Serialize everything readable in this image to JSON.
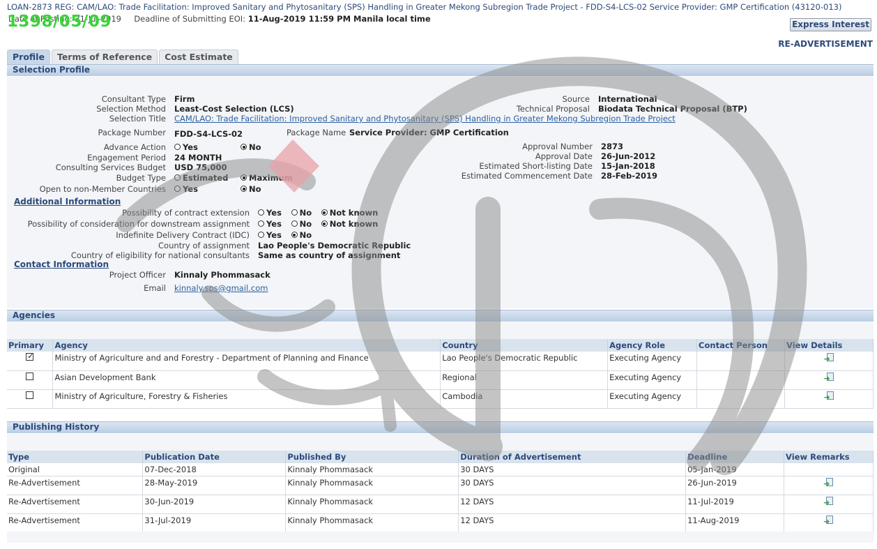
{
  "header": {
    "title": "LOAN-2873 REG: CAM/LAO: Trade Facilitation: Improved Sanitary and Phytosanitary (SPS) Handling in Greater Mekong Subregion Trade Project - FDD-S4-LCS-02 Service Provider: GMP Certification (43120-013)",
    "date_label": "Date of Posting:",
    "date_value": "31-Jul-2019",
    "deadline_label": "Deadline of Submitting EOI:",
    "deadline_value": "11-Aug-2019 11:59 PM Manila local time",
    "stamp": "1398/05/09",
    "express_button": "Express Interest",
    "status": "RE-ADVERTISEMENT"
  },
  "tabs": [
    {
      "label": "Profile",
      "active": true
    },
    {
      "label": "Terms of Reference",
      "active": false
    },
    {
      "label": "Cost Estimate",
      "active": false
    }
  ],
  "selection_profile": {
    "heading": "Selection Profile",
    "consultant_type_label": "Consultant Type",
    "consultant_type": "Firm",
    "selection_method_label": "Selection Method",
    "selection_method": "Least-Cost Selection (LCS)",
    "selection_title_label": "Selection Title",
    "selection_title": "CAM/LAO: Trade Facilitation: Improved Sanitary and Phytosanitary (SPS) Handling in Greater Mekong Subregion Trade Project",
    "package_number_label": "Package Number",
    "package_number": "FDD-S4-LCS-02",
    "package_name_label": "Package Name",
    "package_name": "Service Provider: GMP Certification",
    "advance_action_label": "Advance Action",
    "engagement_period_label": "Engagement Period",
    "engagement_period": "24 MONTH",
    "budget_label": "Consulting Services Budget",
    "budget": "USD 75,000",
    "budget_type_label": "Budget Type",
    "budget_type_estimated": "Estimated",
    "budget_type_maximum": "Maximum",
    "non_member_label": "Open to non-Member Countries",
    "yes": "Yes",
    "no": "No",
    "not_known": "Not known",
    "source_label": "Source",
    "source": "International",
    "technical_proposal_label": "Technical Proposal",
    "technical_proposal": "Biodata Technical Proposal (BTP)",
    "approval_number_label": "Approval Number",
    "approval_number": "2873",
    "approval_date_label": "Approval Date",
    "approval_date": "26-Jun-2012",
    "shortlisting_label": "Estimated Short-listing Date",
    "shortlisting_date": "15-Jan-2018",
    "commencement_label": "Estimated Commencement Date",
    "commencement_date": "28-Feb-2019"
  },
  "additional_info": {
    "heading": "Additional Information",
    "extension_label": "Possibility of contract extension",
    "downstream_label": "Possibility of consideration for downstream assignment",
    "idc_label": "Indefinite Delivery Contract (IDC)",
    "country_label": "Country of assignment",
    "country": "Lao People's Democratic Republic",
    "eligibility_label": "Country of eligibility for national consultants",
    "eligibility": "Same as country of assignment"
  },
  "contact_info": {
    "heading": "Contact Information",
    "officer_label": "Project Officer",
    "officer": "Kinnaly Phommasack",
    "email_label": "Email",
    "email": "kinnaly.sps@gmail.com"
  },
  "agencies": {
    "heading": "Agencies",
    "columns": [
      "Primary",
      "Agency",
      "Country",
      "Agency Role",
      "Contact Person",
      "View Details"
    ],
    "rows": [
      {
        "primary": true,
        "agency": "Ministry of Agriculture and and Forestry - Department of Planning and Finance",
        "country": "Lao People's Democratic Republic",
        "role": "Executing Agency",
        "contact": ""
      },
      {
        "primary": false,
        "agency": "Asian Development Bank",
        "country": "Regional",
        "role": "Executing Agency",
        "contact": ""
      },
      {
        "primary": false,
        "agency": "Ministry of Agriculture, Forestry & Fisheries",
        "country": "Cambodia",
        "role": "Executing Agency",
        "contact": ""
      }
    ]
  },
  "publishing": {
    "heading": "Publishing History",
    "columns": [
      "Type",
      "Publication Date",
      "Published By",
      "Duration of Advertisement",
      "Deadline",
      "View Remarks"
    ],
    "rows": [
      {
        "type": "Original",
        "date": "07-Dec-2018",
        "by": "Kinnaly Phommasack",
        "duration": "30 DAYS",
        "deadline": "05-Jan-2019",
        "remarks": false
      },
      {
        "type": "Re-Advertisement",
        "date": "28-May-2019",
        "by": "Kinnaly Phommasack",
        "duration": "30 DAYS",
        "deadline": "26-Jun-2019",
        "remarks": true
      },
      {
        "type": "Re-Advertisement",
        "date": "30-Jun-2019",
        "by": "Kinnaly Phommasack",
        "duration": "12 DAYS",
        "deadline": "11-Jul-2019",
        "remarks": true
      },
      {
        "type": "Re-Advertisement",
        "date": "31-Jul-2019",
        "by": "Kinnaly Phommasack",
        "duration": "12 DAYS",
        "deadline": "11-Aug-2019",
        "remarks": true
      }
    ]
  },
  "colors": {
    "accent": "#2c4a7a",
    "stamp": "#39d339",
    "watermark": "#8a8a8a"
  }
}
